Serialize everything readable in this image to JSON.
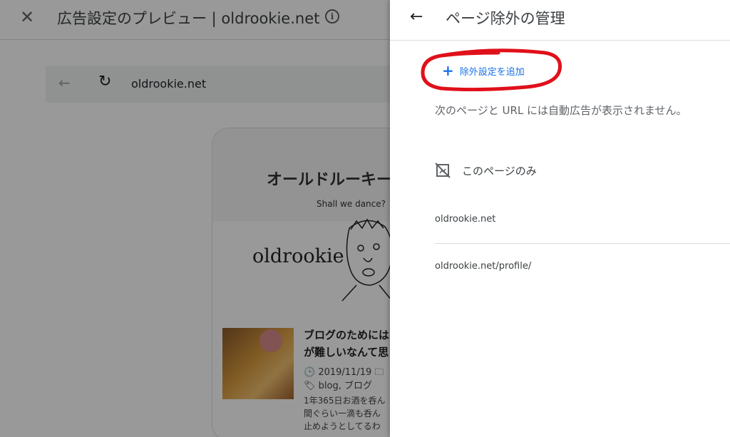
{
  "preview": {
    "close_glyph": "✕",
    "title": "広告設定のプレビュー | oldrookie.net",
    "info_glyph": "i",
    "url_back_glyph": "←",
    "url_reload_glyph": "↻",
    "url": "oldrookie.net",
    "site": {
      "title": "オールドルーキー",
      "tagline": "Shall we dance?",
      "logo_text": "oldrookie",
      "post_title_line1": "ブログのためには",
      "post_title_line2": "が難しいなんて思",
      "post_date": "🕒 2019/11/19  🗀",
      "post_tags": "🏷 blog, ブログ",
      "post_excerpt_line1": "1年365日お酒を呑ん",
      "post_excerpt_line2": "間ぐらい一滴も呑ん",
      "post_excerpt_line3": "止めようとしてるわ"
    }
  },
  "panel": {
    "back_glyph": "←",
    "title": "ページ除外の管理",
    "add_button_plus": "+",
    "add_button_label": "除外設定を追加",
    "description": "次のページと URL には自動広告が表示されません。",
    "section_label": "このページのみ",
    "section_icon": "no-page-icon",
    "urls": [
      "oldrookie.net",
      "oldrookie.net/profile/"
    ]
  },
  "colors": {
    "accent": "#1a73e8",
    "annotation": "#e0101a",
    "scrim": "rgba(0,0,0,0.40)"
  }
}
